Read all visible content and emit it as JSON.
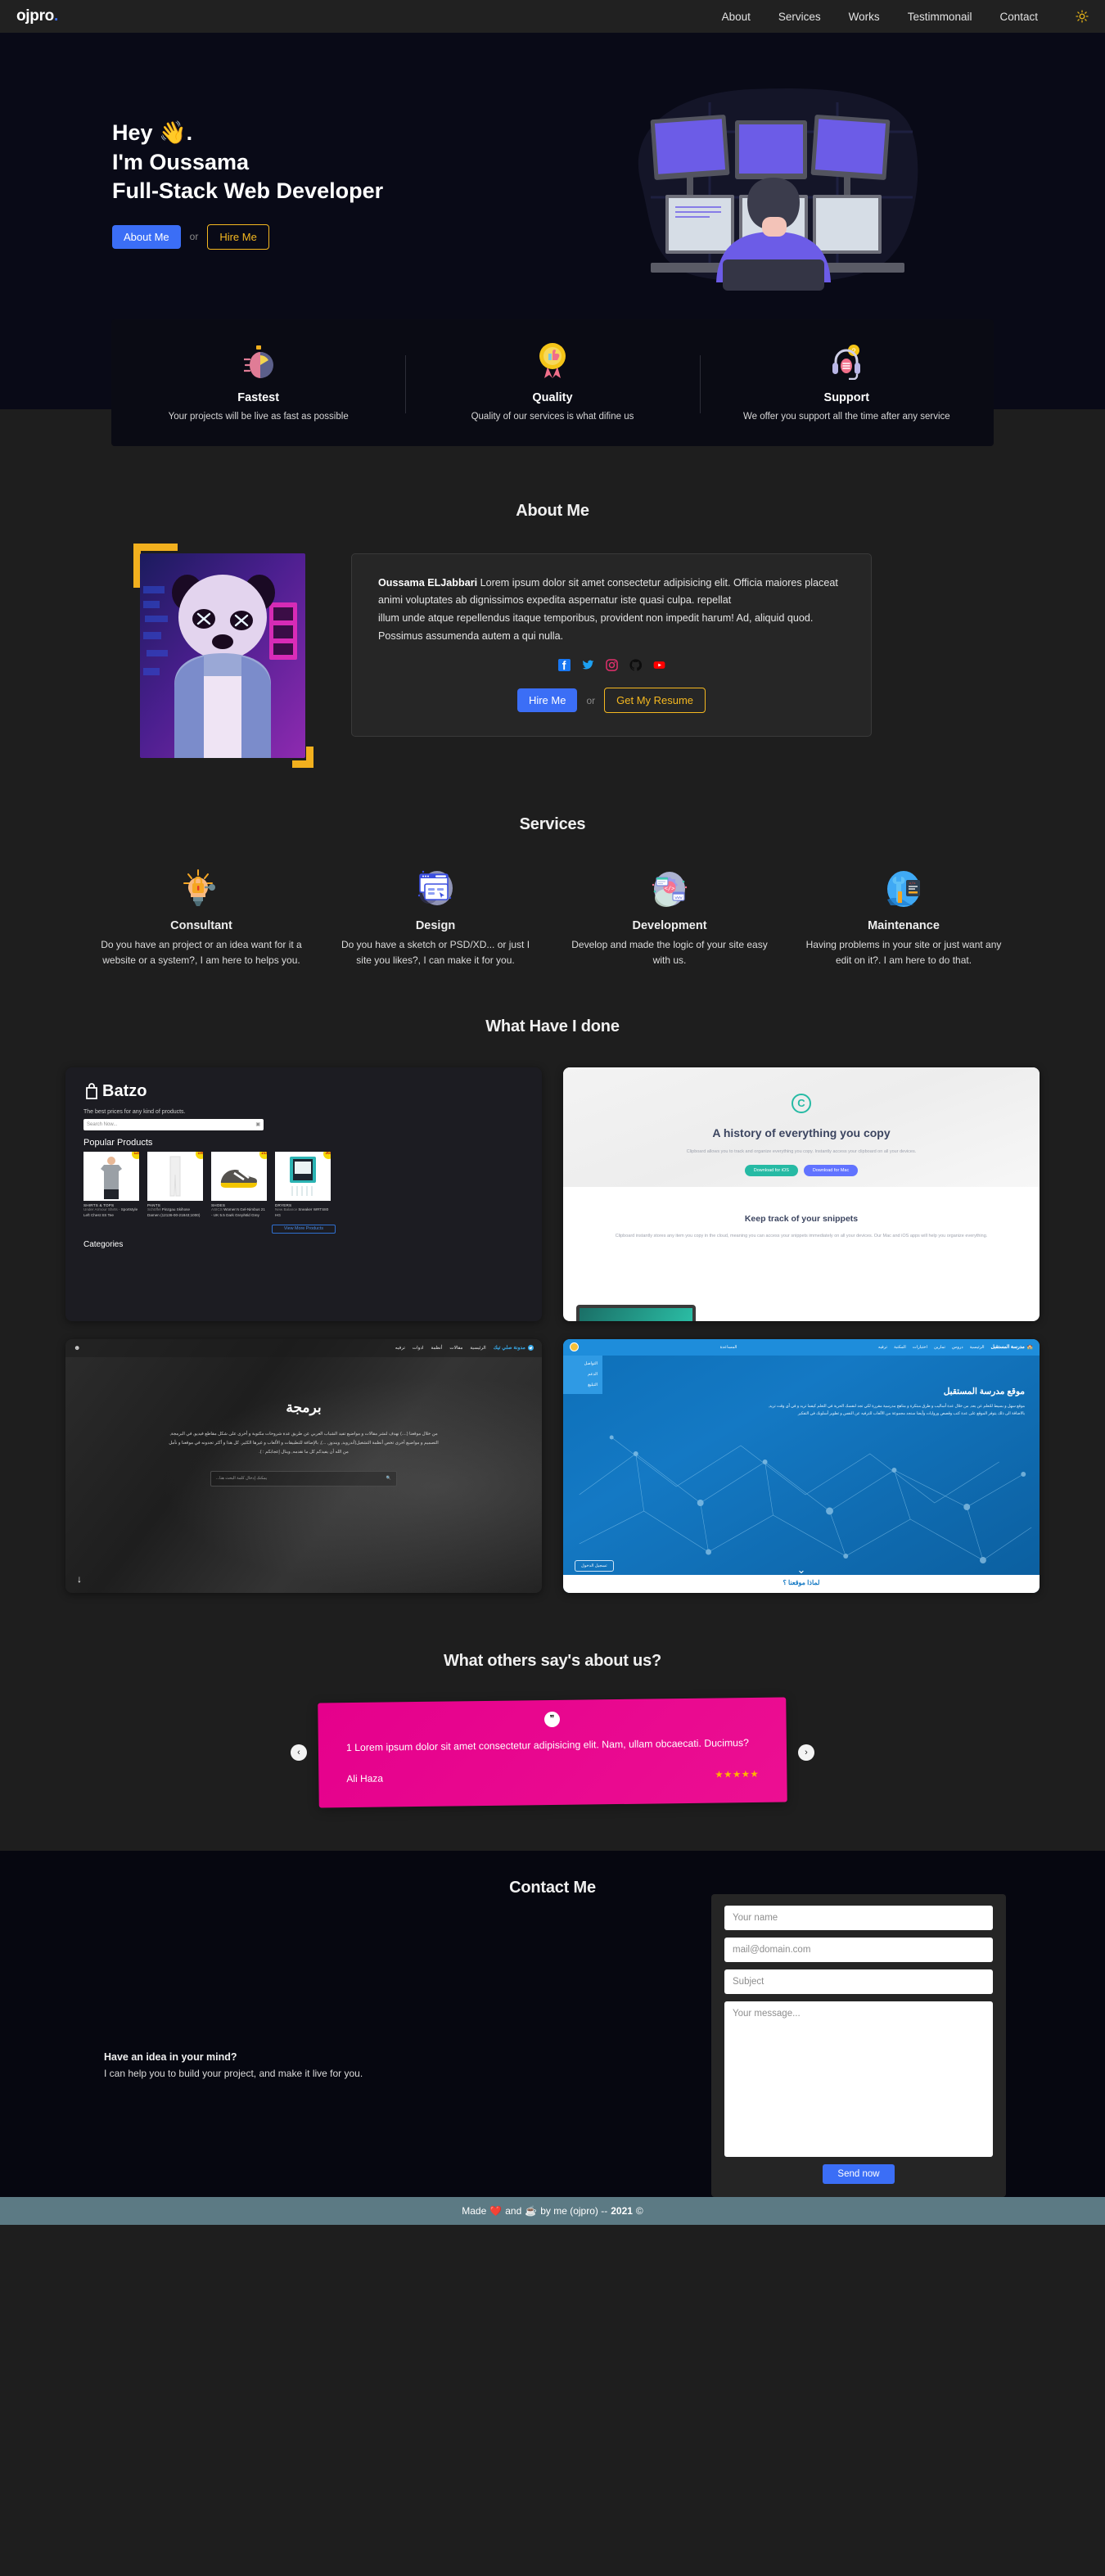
{
  "navbar": {
    "logo": "ojpro",
    "logo_dot": ".",
    "links": [
      {
        "label": "About"
      },
      {
        "label": "Services"
      },
      {
        "label": "Works"
      },
      {
        "label": "Testimmonail"
      },
      {
        "label": "Contact"
      }
    ],
    "theme_toggle_icon": "sun-icon"
  },
  "hero": {
    "greeting": "Hey 👋.",
    "name": "I'm Oussama",
    "role": "Full-Stack Web Developer",
    "primary_button": "About Me",
    "or_text": "or",
    "outline_button": "Hire Me",
    "illustration": "developer-at-monitors-illustration"
  },
  "features": [
    {
      "icon": "stopwatch-icon",
      "title": "Fastest",
      "desc": "Your projects will be live as fast as possible"
    },
    {
      "icon": "quality-medal-icon",
      "title": "Quality",
      "desc": "Quality of our services is what difine us"
    },
    {
      "icon": "headset-support-icon",
      "title": "Support",
      "desc": "We offer you support all the time after any service"
    }
  ],
  "about": {
    "title": "About Me",
    "image_alt": "neon-panda-portrait",
    "name": "Oussama ELJabbari",
    "paragraph1": " Lorem ipsum dolor sit amet consectetur adipisicing elit. Officia maiores placeat animi voluptates ab dignissimos expedita aspernatur iste quasi culpa. repellat",
    "paragraph2": "illum unde atque repellendus itaque temporibus, provident non impedit harum! Ad, aliquid quod. Possimus assumenda autem a qui nulla.",
    "socials": [
      {
        "name": "facebook-icon",
        "color": "#1877f2"
      },
      {
        "name": "twitter-icon",
        "color": "#1da1f2"
      },
      {
        "name": "instagram-icon",
        "color": "#e1306c"
      },
      {
        "name": "github-icon",
        "color": "#0d0d0d"
      },
      {
        "name": "youtube-icon",
        "color": "#ff0000"
      }
    ],
    "primary_button": "Hire Me",
    "or_text": "or",
    "outline_button": "Get My Resume"
  },
  "services": {
    "title": "Services",
    "items": [
      {
        "icon": "lightbulb-lock-icon",
        "title": "Consultant",
        "desc": "Do you have an project or an idea want for it a website or a system?, I am here to helps you."
      },
      {
        "icon": "design-window-icon",
        "title": "Design",
        "desc": "Do you have a sketch or PSD/XD... or just I site you likes?, I can make it for you."
      },
      {
        "icon": "gear-code-icon",
        "title": "Development",
        "desc": "Develop and made the logic of your site easy with us."
      },
      {
        "icon": "wrench-screwdriver-icon",
        "title": "Maintenance",
        "desc": "Having problems in your site or just want any edit on it?. I am here to do that."
      }
    ]
  },
  "works": {
    "title": "What Have I done",
    "items": [
      {
        "kind": "batzo",
        "logo": "Batzo",
        "tagline": "The best prices for any kind of products.",
        "search_placeholder": "Search Now...",
        "popular_heading": "Popular Products",
        "products": [
          {
            "badge": "125",
            "category": "SHIRTS & TOPS",
            "brand": "Under Armour Shirts -",
            "name": " Sportstyle Left Chest SS Tee"
          },
          {
            "badge": "195",
            "category": "PANTS",
            "brand": "Schöffel",
            "name": " Pinzgau Skihose Damen (12136-00-21843;1000)"
          },
          {
            "badge": "215",
            "category": "SHOES",
            "brand": "ASICS",
            "name": " Women's Gel-Nimbus 21 - UK 5.5 Dark Grey/Mid Grey"
          },
          {
            "badge": "365",
            "category": "DRYERS",
            "brand": "New Balance",
            "name": " Sneaker WRTS80 HG"
          }
        ],
        "more_button": "View More Products",
        "categories_heading": "Categories"
      },
      {
        "kind": "clipboard",
        "logo_letter": "C",
        "heading": "A history of everything you copy",
        "sub": "Clipboard allows you to track and organize everything you copy. Instantly access your clipboard on all your devices.",
        "btn_ios": "Download for iOS",
        "btn_mac": "Download for Mac",
        "heading2": "Keep track of your snippets",
        "sub2": "Clipboard instantly stores any item you copy in the cloud, meaning you can access your snippets immediately on all your devices. Our Mac and iOS apps will help you organize everything."
      },
      {
        "kind": "arblog",
        "brand": "مدونة صلي تيك",
        "nav": [
          "الرئيسية",
          "مقالات",
          "أنظمة",
          "ادوات",
          "ترفيه"
        ],
        "heading": "برمجة",
        "paragraph": "من خلال موقعنا (....) نهدف لنشر مقالات و مواضيع تفيد الشباب العربي عن طريق عدة شروحات مكتوبة و أخرى على شكل مقاطع فيديو, في البرمجة, التصميم و مواضيع أخرى تخص أنظمة التشغيل(أندرويد, ويندوز, ...), بالإضافة للتطبيقات و الألعاب و غيرها الكثير. كل هذا و أكثر تجدونه في موقعنا و نأمل من الله أن يفيدكم كل ما نقدمه, وينال إعجابكم : ).",
        "search_placeholder": "يمكنك إدخال كلمة البحث هنا..."
      },
      {
        "kind": "arschool",
        "brand": "مدرسة المستقبل",
        "nav": [
          "الرئيسية",
          "دروس",
          "تمارين",
          "اختبارات",
          "المكتبة",
          "ترفيه"
        ],
        "help": "المساعدة",
        "dropdown": [
          "التواصل",
          "الدعم",
          "التبليغ"
        ],
        "heading": "موقع مدرسة المستقبل",
        "paragraph": "موقع سهل و بسيط للتعلم عن بعد, من خلال عدة أساليب و طرق مبتكرة و مناهج مدرسية مقررة لكي تجد لنفسك الحرية في التعلم كيفما تريد و في أي وقت تريد, بالاضافة الى ذلك يتوفر الموقع على عدة كتب وقصص وروايات وأيضا سنجد مجموعة من الألعاب للترفيه عن النفس و تطوير أسلوبك في التفكير",
        "login": "تسجيل الدخول",
        "footer_heading": "لماذا موقعنا ؟"
      }
    ]
  },
  "testimonials": {
    "title": "What others say's about us?",
    "prev_icon": "chevron-left-icon",
    "next_icon": "chevron-right-icon",
    "quote_icon": "quote-icon",
    "items": [
      {
        "text": "1 Lorem ipsum dolor sit amet consectetur adipisicing elit. Nam, ullam obcaecati. Ducimus?",
        "author": "Ali Haza",
        "stars": "★★★★★"
      }
    ]
  },
  "contact": {
    "title": "Contact Me",
    "left_heading": "Have an idea in your mind?",
    "left_text": "I can help you to build your project, and make it live for you.",
    "name_placeholder": "Your name",
    "email_placeholder": "mail@domain.com",
    "subject_placeholder": "Subject",
    "message_placeholder": "Your message...",
    "submit_label": "Send now"
  },
  "footer": {
    "prefix": "Made",
    "heart": "❤️",
    "and": "and",
    "coffee": "☕",
    "suffix": "by me (ojpro) --",
    "year": "2021",
    "copyright": "©"
  },
  "colors": {
    "accent_blue": "#3b6ef6",
    "accent_yellow": "#f5b820",
    "bg_dark": "#1e1e1e",
    "bg_hero": "#090a17",
    "testimonial_pink": "#e5008c",
    "footer_bg": "#5c7a84"
  }
}
